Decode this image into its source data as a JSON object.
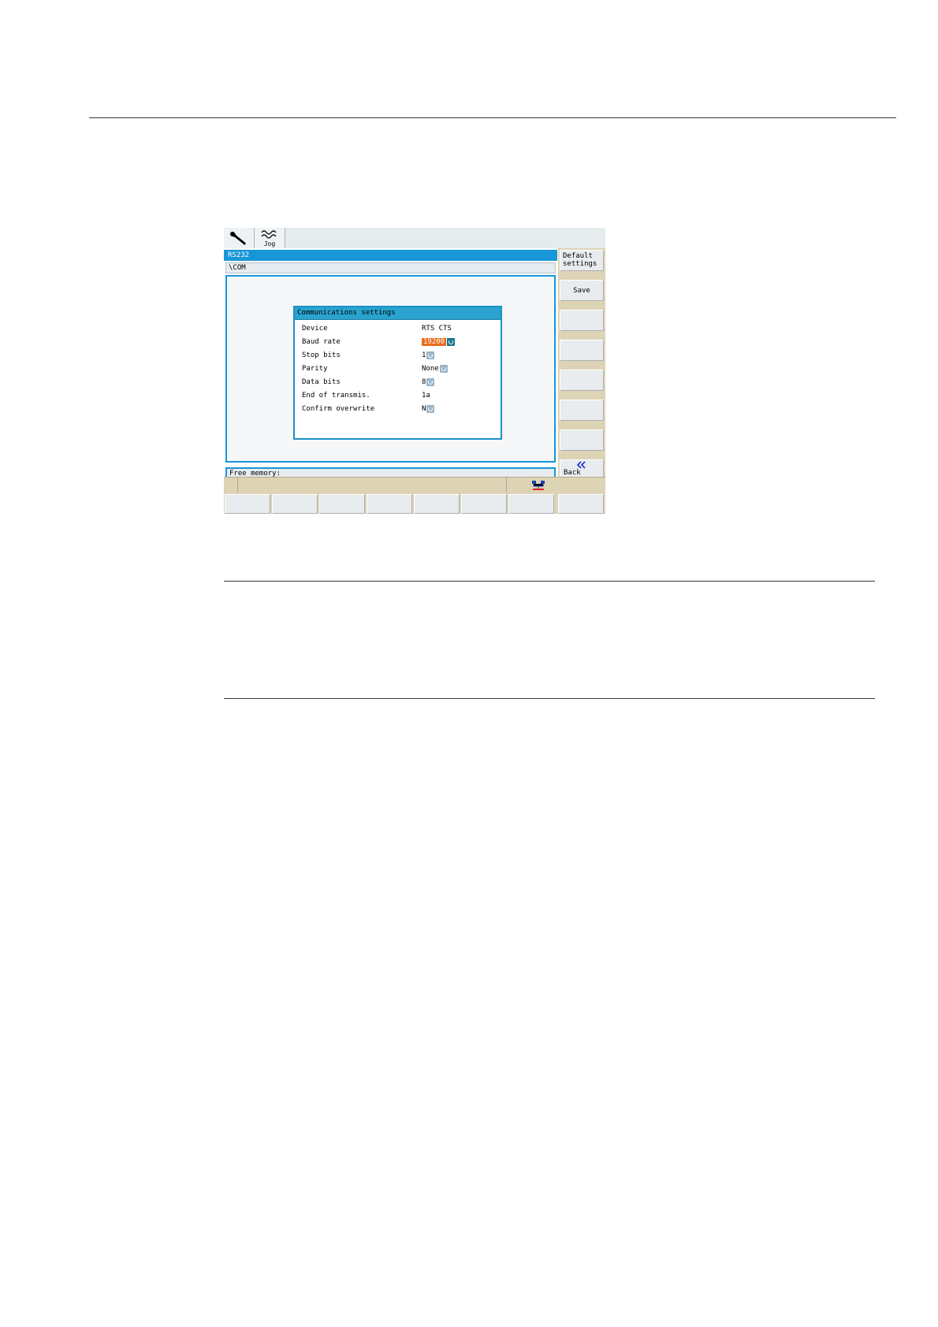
{
  "screen": {
    "topbar": {
      "jog_label": "Jog"
    },
    "title": "RS232",
    "path": "\\COM",
    "dialog": {
      "title": "Communications settings",
      "rows": [
        {
          "label": "Device",
          "value": "RTS CTS"
        },
        {
          "label": "Baud rate",
          "value": "19200"
        },
        {
          "label": "Stop bits",
          "value": "1"
        },
        {
          "label": "Parity",
          "value": "None"
        },
        {
          "label": "Data bits",
          "value": "8"
        },
        {
          "label": "End of transmis.",
          "value": "1a"
        },
        {
          "label": "Confirm overwrite",
          "value": "N"
        }
      ]
    },
    "status": "Free memory:",
    "softkeys": {
      "default_settings": "Default settings",
      "save": "Save",
      "back": "Back"
    },
    "icons": [
      "wrench-icon",
      "jog-icon",
      "spin-icon",
      "network-icon",
      "double-chevron-left-icon"
    ],
    "colors": {
      "title_bar": "#1796d8",
      "dialog_title": "#2aa3cf",
      "selected": "#e96b1a",
      "softkey_bar": "#ddd3b5"
    }
  }
}
